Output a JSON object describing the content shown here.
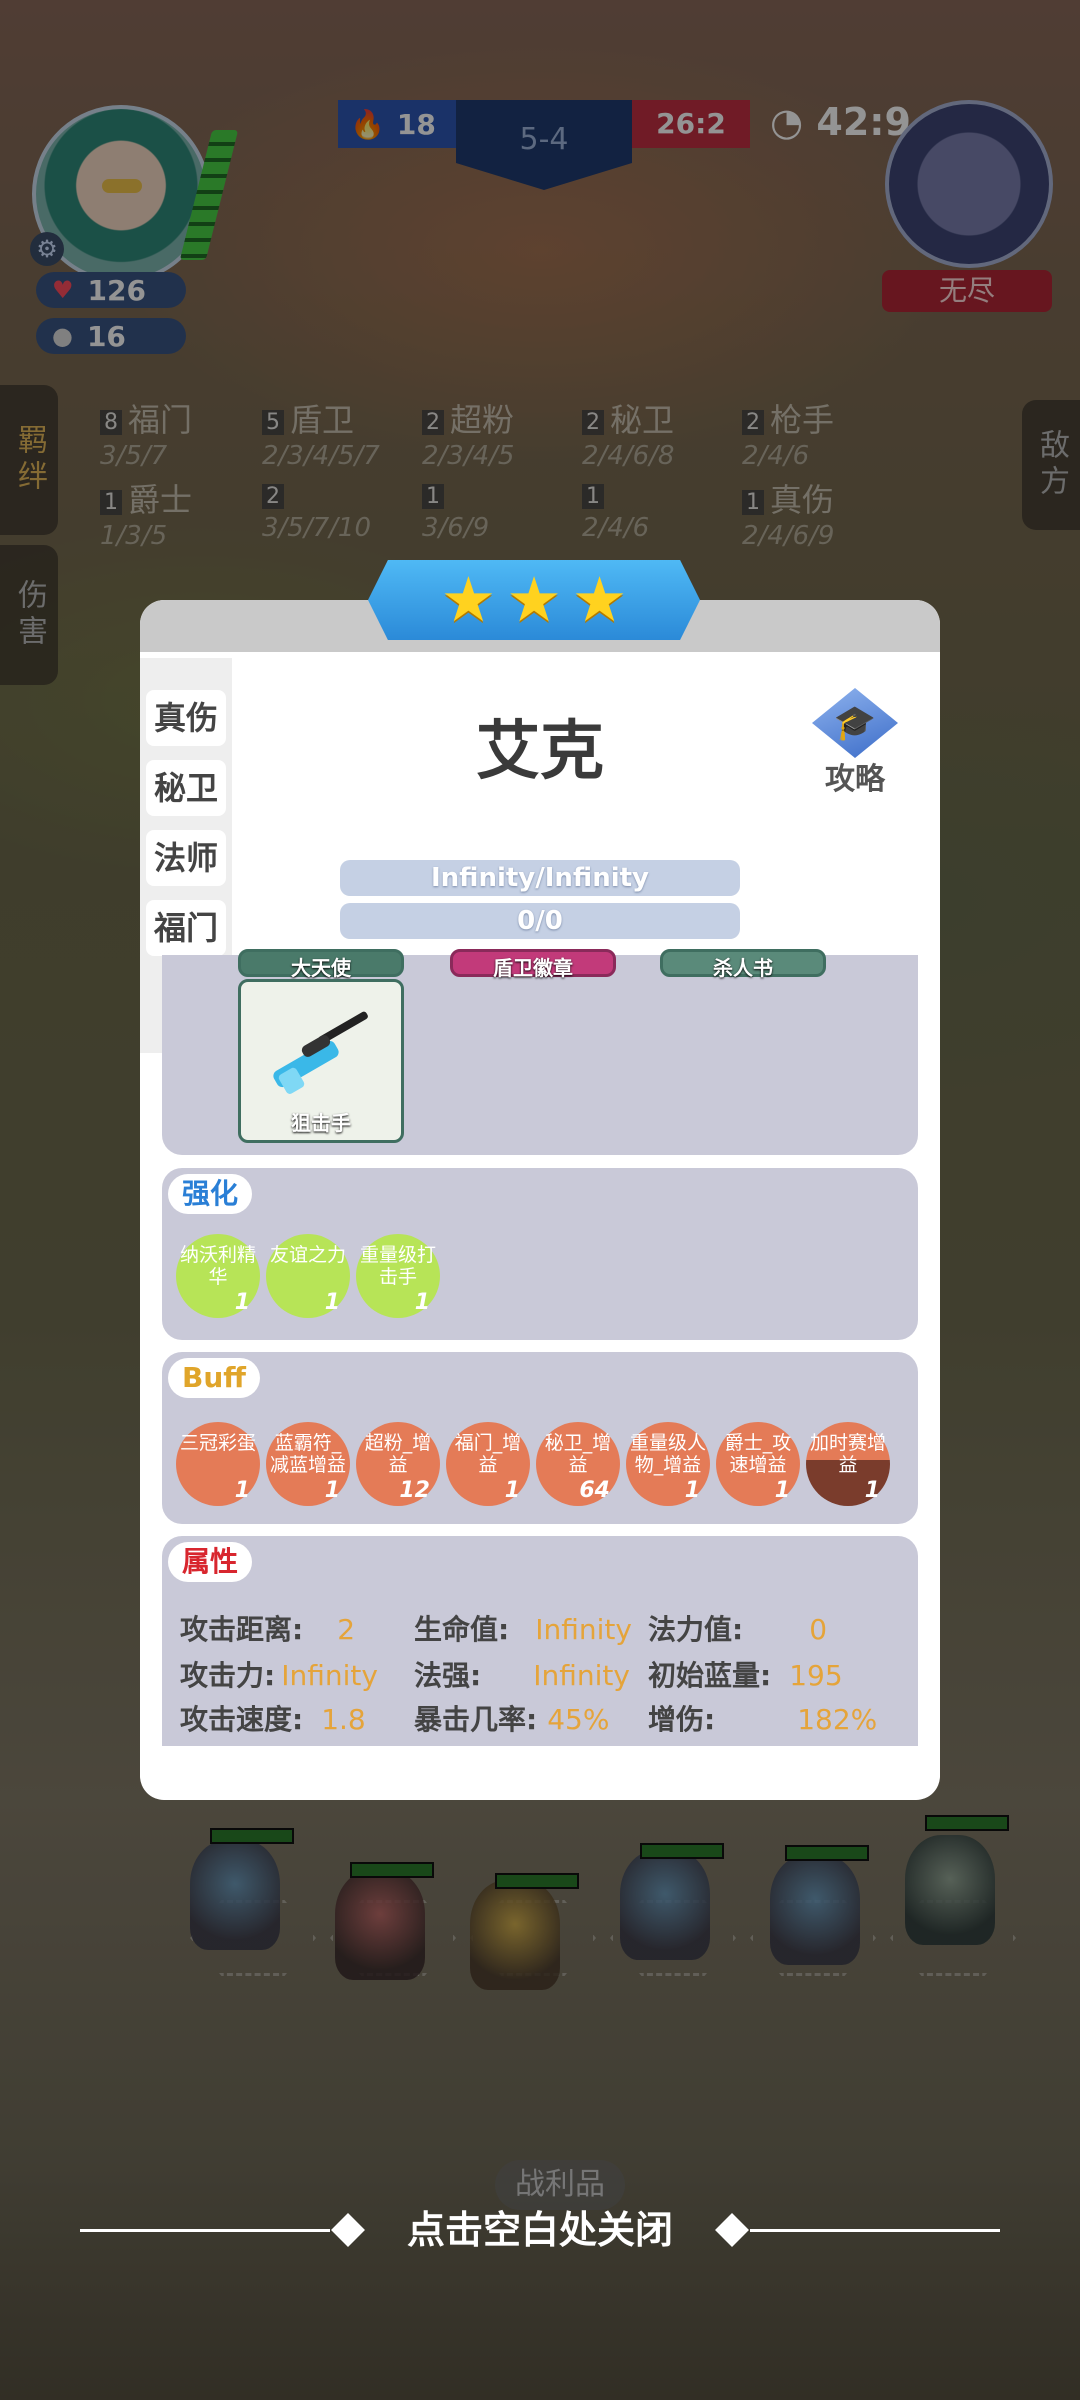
{
  "hud": {
    "hp": "126",
    "gold": "16",
    "blue_score": "18",
    "stage": "5-4",
    "red_score": "26:2",
    "timer": "42:9",
    "enemy_label": "无尽"
  },
  "side_tabs": {
    "bond": "羁绊",
    "damage": "伤害",
    "enemy": "敌方"
  },
  "synergies": [
    {
      "count": "8",
      "name": "福门",
      "steps": "3/5/7"
    },
    {
      "count": "5",
      "name": "盾卫",
      "steps": "2/3/4/5/7"
    },
    {
      "count": "2",
      "name": "超粉",
      "steps": "2/3/4/5"
    },
    {
      "count": "2",
      "name": "秘卫",
      "steps": "2/4/6/8"
    },
    {
      "count": "2",
      "name": "枪手",
      "steps": "2/4/6"
    },
    {
      "count": "1",
      "name": "爵士",
      "steps": "1/3/5"
    },
    {
      "count": "2",
      "name": "",
      "steps": "3/5/7/10"
    },
    {
      "count": "1",
      "name": "",
      "steps": "3/6/9"
    },
    {
      "count": "1",
      "name": "",
      "steps": "2/4/6"
    },
    {
      "count": "1",
      "name": "真伤",
      "steps": "2/4/6/9"
    }
  ],
  "modal": {
    "hero_name": "艾克",
    "strategy_label": "攻略",
    "hp_bar": "Infinity/Infinity",
    "mana_bar": "0/0",
    "left_tabs": [
      "真伤",
      "秘卫",
      "法师",
      "福门"
    ],
    "equip_partial": [
      "大天使",
      "盾卫徽章",
      "杀人书"
    ],
    "equip_full": "狙击手",
    "enhance_title": "强化",
    "enhance": [
      {
        "name": "纳沃利精华",
        "count": "1"
      },
      {
        "name": "友谊之力",
        "count": "1"
      },
      {
        "name": "重量级打击手",
        "count": "1"
      }
    ],
    "buff_title": "Buff",
    "buffs": [
      {
        "name": "三冠彩蛋",
        "count": "1"
      },
      {
        "name": "蓝霸符_减蓝增益",
        "count": "1"
      },
      {
        "name": "超粉_增益",
        "count": "12"
      },
      {
        "name": "福门_增益",
        "count": "1"
      },
      {
        "name": "秘卫_增益",
        "count": "64"
      },
      {
        "name": "重量级人物_增益",
        "count": "1"
      },
      {
        "name": "爵士_攻速增益",
        "count": "1"
      },
      {
        "name": "加时赛增益",
        "count": "1"
      }
    ],
    "attr_title": "属性",
    "attrs": {
      "range_label": "攻击距离:",
      "range": "2",
      "hp_label": "生命值:",
      "hp": "Infinity",
      "mana_label": "法力值:",
      "mana": "0",
      "atk_label": "攻击力:",
      "atk": "Infinity",
      "ap_label": "法强:",
      "ap": "Infinity",
      "init_mana_label": "初始蓝量:",
      "init_mana": "195",
      "as_label": "攻击速度:",
      "as": "1.8",
      "crit_label": "暴击几率:",
      "crit": "45%",
      "dmg_label": "增伤:",
      "dmg": "182%"
    }
  },
  "loot_label": "战利品",
  "close_hint": "点击空白处关闭",
  "colors": {
    "attr_value": "#e5a43a",
    "buff": "#e47b57",
    "enhance": "#b7e457",
    "star_banner": "#3a9be8"
  }
}
